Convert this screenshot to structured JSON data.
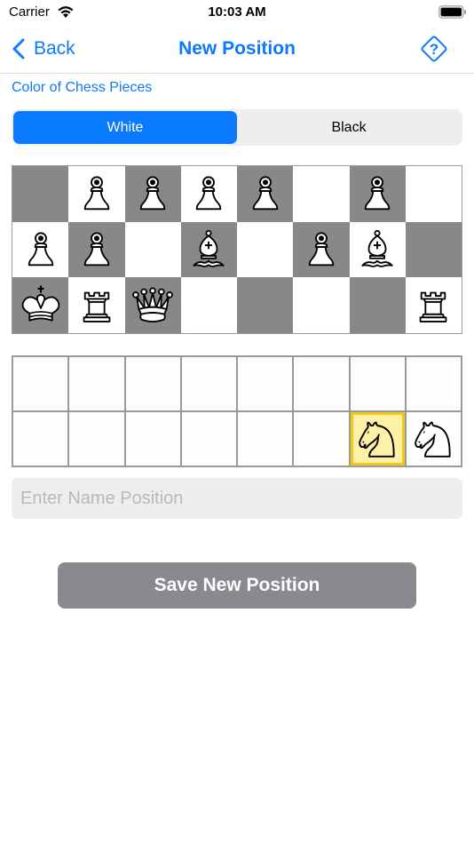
{
  "status_bar": {
    "carrier": "Carrier",
    "time": "10:03 AM",
    "wifi_icon": "wifi-icon",
    "battery_icon": "battery-icon"
  },
  "nav": {
    "back_label": "Back",
    "title": "New Position",
    "help_icon": "question-mark-icon",
    "accent_color": "#0a7aff"
  },
  "color_section": {
    "label": "Color of Chess Pieces",
    "options": [
      "White",
      "Black"
    ],
    "selected": "White"
  },
  "board": {
    "rows": [
      [
        {
          "shade": "dark",
          "piece": ""
        },
        {
          "shade": "light",
          "piece": "pawn"
        },
        {
          "shade": "dark",
          "piece": "pawn"
        },
        {
          "shade": "light",
          "piece": "pawn"
        },
        {
          "shade": "dark",
          "piece": "pawn"
        },
        {
          "shade": "light",
          "piece": ""
        },
        {
          "shade": "dark",
          "piece": "pawn"
        },
        {
          "shade": "light",
          "piece": ""
        }
      ],
      [
        {
          "shade": "light",
          "piece": "pawn"
        },
        {
          "shade": "dark",
          "piece": "pawn"
        },
        {
          "shade": "light",
          "piece": ""
        },
        {
          "shade": "dark",
          "piece": "bishop"
        },
        {
          "shade": "light",
          "piece": ""
        },
        {
          "shade": "dark",
          "piece": "pawn"
        },
        {
          "shade": "light",
          "piece": "bishop"
        },
        {
          "shade": "dark",
          "piece": ""
        }
      ],
      [
        {
          "shade": "dark",
          "piece": "king"
        },
        {
          "shade": "light",
          "piece": "rook"
        },
        {
          "shade": "dark",
          "piece": "queen"
        },
        {
          "shade": "light",
          "piece": ""
        },
        {
          "shade": "dark",
          "piece": ""
        },
        {
          "shade": "light",
          "piece": ""
        },
        {
          "shade": "dark",
          "piece": ""
        },
        {
          "shade": "light",
          "piece": "rook"
        }
      ]
    ]
  },
  "tray": {
    "rows": [
      [
        "",
        "",
        "",
        "",
        "",
        "",
        "",
        ""
      ],
      [
        "",
        "",
        "",
        "",
        "",
        "",
        "knight",
        "knight"
      ]
    ],
    "selected": [
      1,
      6
    ],
    "highlight_color": "#f2c71c"
  },
  "name_input": {
    "placeholder": "Enter Name Position",
    "value": ""
  },
  "save_button": {
    "label": "Save New Position"
  }
}
